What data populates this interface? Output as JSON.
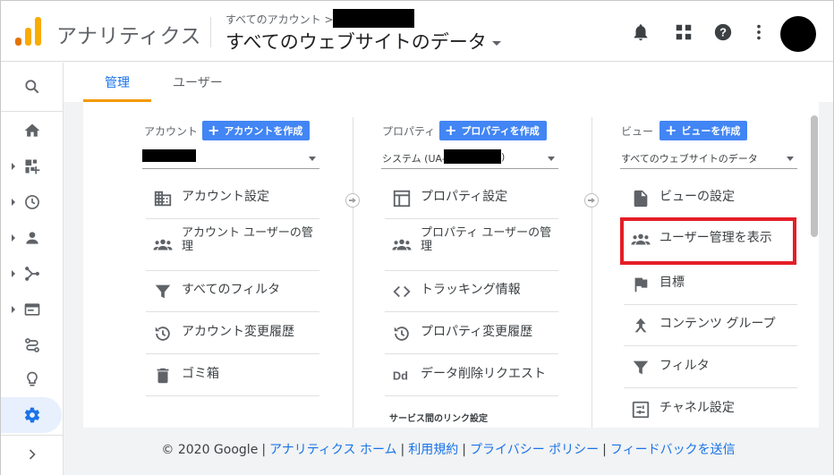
{
  "header": {
    "app_name": "アナリティクス",
    "breadcrumb": "すべてのアカウント >",
    "view_title": "すべてのウェブサイトのデータ"
  },
  "tabs": [
    {
      "label": "管理",
      "active": true
    },
    {
      "label": "ユーザー",
      "active": false
    }
  ],
  "nav_icons": [
    "search-icon",
    "home-icon",
    "customization-icon",
    "realtime-icon",
    "audience-icon",
    "acquisition-icon",
    "behavior-icon",
    "conversions-icon",
    "attribution-icon",
    "discover-icon",
    "admin-gear-icon",
    "expand-icon"
  ],
  "columns": {
    "account": {
      "header": "アカウント",
      "create_label": "アカウントを作成",
      "items": [
        {
          "label": "アカウント設定",
          "icon": "building-icon"
        },
        {
          "label": "アカウント ユーザーの管理",
          "icon": "people-icon"
        },
        {
          "label": "すべてのフィルタ",
          "icon": "filter-icon"
        },
        {
          "label": "アカウント変更履歴",
          "icon": "history-icon"
        },
        {
          "label": "ゴミ箱",
          "icon": "trash-icon"
        }
      ]
    },
    "property": {
      "header": "プロパティ",
      "create_label": "プロパティを作成",
      "selector_prefix": "システム (UA-",
      "selector_suffix": ")",
      "items": [
        {
          "label": "プロパティ設定",
          "icon": "property-settings-icon"
        },
        {
          "label": "プロパティ ユーザーの管理",
          "icon": "people-icon"
        },
        {
          "label": "トラッキング情報",
          "icon": "code-icon"
        },
        {
          "label": "プロパティ変更履歴",
          "icon": "history-icon"
        },
        {
          "label": "データ削除リクエスト",
          "icon": "dd-icon"
        }
      ],
      "section_title": "サービス間のリンク設定"
    },
    "view": {
      "header": "ビュー",
      "create_label": "ビューを作成",
      "selector_text": "すべてのウェブサイトのデータ",
      "items": [
        {
          "label": "ビューの設定",
          "icon": "document-icon"
        },
        {
          "label": "ユーザー管理を表示",
          "icon": "people-icon",
          "highlighted": true
        },
        {
          "label": "目標",
          "icon": "flag-icon"
        },
        {
          "label": "コンテンツ グループ",
          "icon": "content-group-icon"
        },
        {
          "label": "フィルタ",
          "icon": "filter-icon"
        },
        {
          "label": "チャネル設定",
          "icon": "channel-settings-icon"
        }
      ]
    }
  },
  "footer": {
    "copyright": "© 2020 Google",
    "links": [
      "アナリティクス ホーム",
      "利用規約",
      "プライバシー ポリシー",
      "フィードバックを送信"
    ]
  },
  "colors": {
    "accent": "#1a73e8",
    "button": "#4285f4",
    "tab_underline": "#f29900",
    "highlight": "#e41e26",
    "logo_orange": "#f9ab00",
    "logo_dark": "#e37400"
  }
}
